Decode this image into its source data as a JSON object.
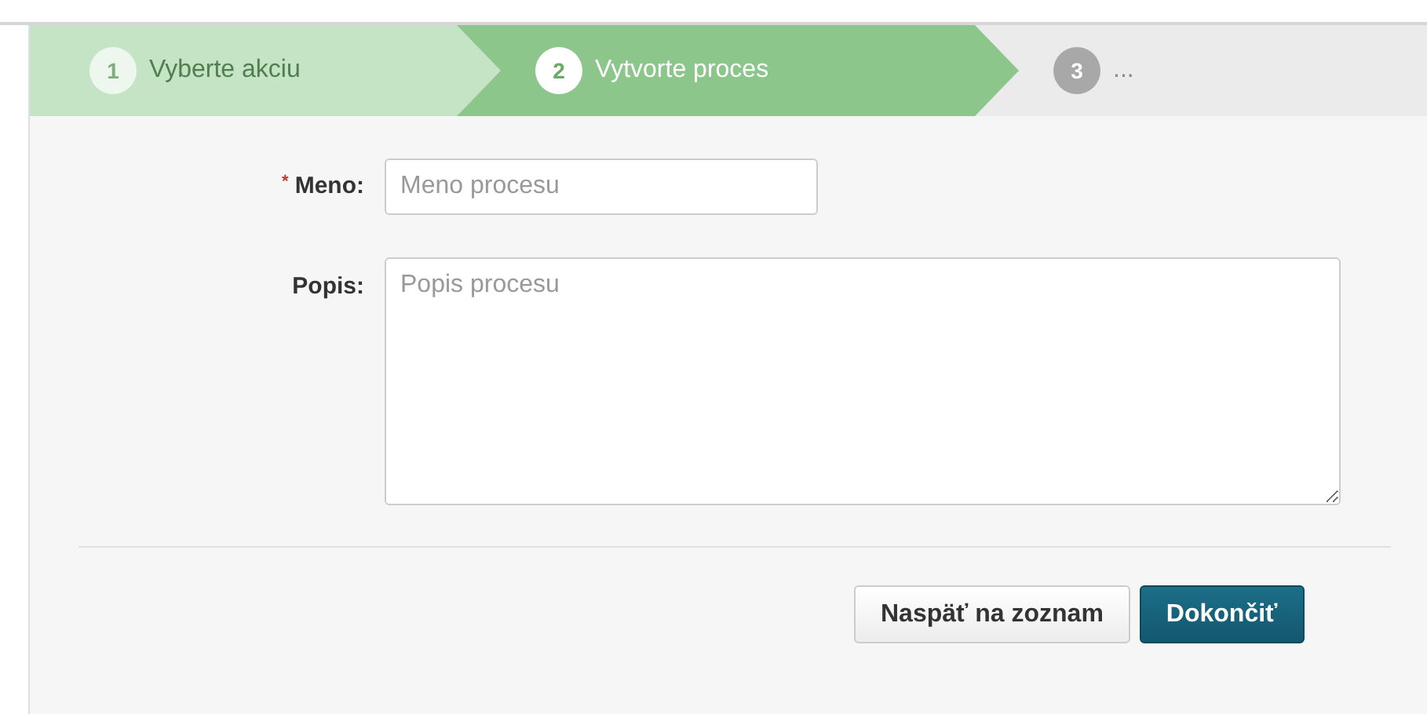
{
  "steps": [
    {
      "number": "1",
      "label": "Vyberte akciu",
      "done": true,
      "selected": false
    },
    {
      "number": "2",
      "label": "Vytvorte proces",
      "done": false,
      "selected": true
    },
    {
      "number": "3",
      "label": "...",
      "done": false,
      "selected": false
    }
  ],
  "fields": [
    {
      "kind": "input",
      "label": "Meno:",
      "required_mark": "*",
      "placeholder": "Meno procesu"
    },
    {
      "kind": "textarea",
      "label": "Popis:",
      "placeholder": "Popis procesu"
    }
  ],
  "buttons": [
    {
      "label": "Naspäť na zoznam",
      "primary": false
    },
    {
      "label": "Dokončiť",
      "primary": true
    }
  ]
}
